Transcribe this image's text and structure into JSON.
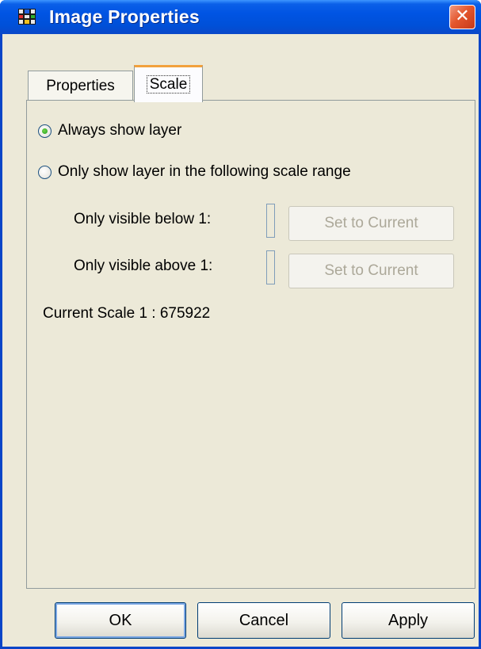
{
  "window": {
    "title": "Image Properties",
    "close_glyph": "✕",
    "icon": "grid-app-icon"
  },
  "tabs": [
    {
      "label": "Properties",
      "selected": false
    },
    {
      "label": "Scale",
      "selected": true
    }
  ],
  "scale_panel": {
    "always_show": {
      "label": "Always show layer",
      "checked": true
    },
    "range_show": {
      "label": "Only show layer in the following scale range",
      "checked": false
    },
    "below": {
      "label": "Only visible below 1:",
      "value": "",
      "button": "Set to Current",
      "enabled": false
    },
    "above": {
      "label": "Only visible above 1:",
      "value": "",
      "button": "Set to Current",
      "enabled": false
    },
    "current_scale": "Current Scale 1 : 675922"
  },
  "buttons": {
    "ok": "OK",
    "cancel": "Cancel",
    "apply": "Apply"
  },
  "colors": {
    "titlebar": "#0054e3",
    "window_bg": "#ece9d8",
    "tab_accent": "#f2a13c",
    "close_button": "#e4572e"
  }
}
